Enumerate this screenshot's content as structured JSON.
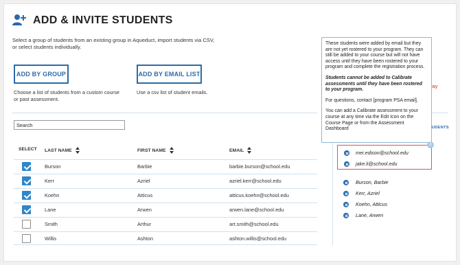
{
  "header": {
    "title": "ADD & INVITE STUDENTS",
    "intro": "Select a group of students from an existing group in Aqueduct, import students via CSV, or select students individually."
  },
  "actions": {
    "add_by_group_label": "ADD BY GROUP",
    "add_by_group_desc": "Choose a list of students from a custom course or past assessment.",
    "add_by_email_label": "ADD BY EMAIL LIST",
    "add_by_email_desc": "Use a csv list of student emails."
  },
  "search": {
    "placeholder": "Search",
    "value": "Search"
  },
  "table": {
    "headers": {
      "select": "SELECT",
      "last_name": "LAST NAME",
      "first_name": "FIRST NAME",
      "email": "EMAIL"
    },
    "rows": [
      {
        "checked": true,
        "last": "Burson",
        "first": "Barbie",
        "email": "barbie.burson@school.edu"
      },
      {
        "checked": true,
        "last": "Kerr",
        "first": "Azriel",
        "email": "azriel.kerr@school.edu"
      },
      {
        "checked": true,
        "last": "Koehn",
        "first": "Atticus",
        "email": "atticus.koehn@school.edu"
      },
      {
        "checked": true,
        "last": "Lane",
        "first": "Arwen",
        "email": "arwen.lane@school.edu"
      },
      {
        "checked": false,
        "last": "Smith",
        "first": "Arthur",
        "email": "art.smith@school.edu"
      },
      {
        "checked": false,
        "last": "Willis",
        "first": "Ashton",
        "email": "ashton.willis@school.edu"
      }
    ]
  },
  "tooltip": {
    "p1": "These students were added by email but they are not yet rostered to your program. They can still be added to your course but will not have access until they have been rostered to your program and complete the registration process.",
    "p2": "Students cannot be added to Calibrate assessments until they have been rostered to your program.",
    "p3": "For questions, contact [program PSA email].",
    "p4": "You can add a Calibrate assessment to your course at any time via the Edit Icon on the Course Page or from the Assessment Dashboard"
  },
  "right_panel": {
    "red_text": "lay",
    "heading_partial": "TUDENTS",
    "info_label": "i",
    "unrostered": [
      "mei.edison@school.edu",
      "jake.li@school.edu"
    ],
    "selected": [
      "Burson, Barbie",
      "Kerr, Azriel",
      "Koehn, Atticus",
      "Lane, Arwen"
    ]
  },
  "colors": {
    "accent": "#2b6aa8",
    "checkbox": "#2f86c9",
    "warning": "#d9535a",
    "divider": "#cfe0ee"
  }
}
